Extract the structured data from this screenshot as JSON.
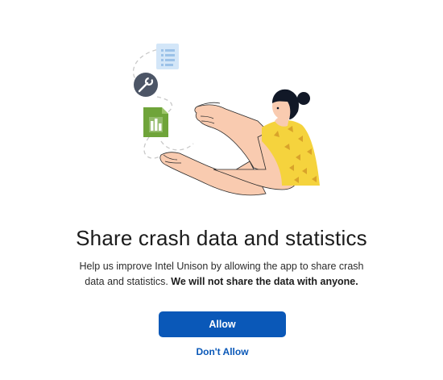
{
  "dialog": {
    "title": "Share crash data and statistics",
    "description": "Help us improve Intel Unison by allowing the app to share crash data and statistics.",
    "description_bold": "We will not share the data with anyone.",
    "allow_label": "Allow",
    "dont_allow_label": "Don't Allow"
  },
  "illustration": {
    "icons": [
      "document-list-icon",
      "wrench-icon",
      "chart-file-icon"
    ],
    "figure": "person-pointing-illustration"
  },
  "colors": {
    "accent": "#0a58b8",
    "shirt": "#f5d33d",
    "skin": "#f9cbb0",
    "chart_file": "#6fa43a",
    "wrench_circle": "#4c5566",
    "doc_icon": "#cde3f7"
  }
}
